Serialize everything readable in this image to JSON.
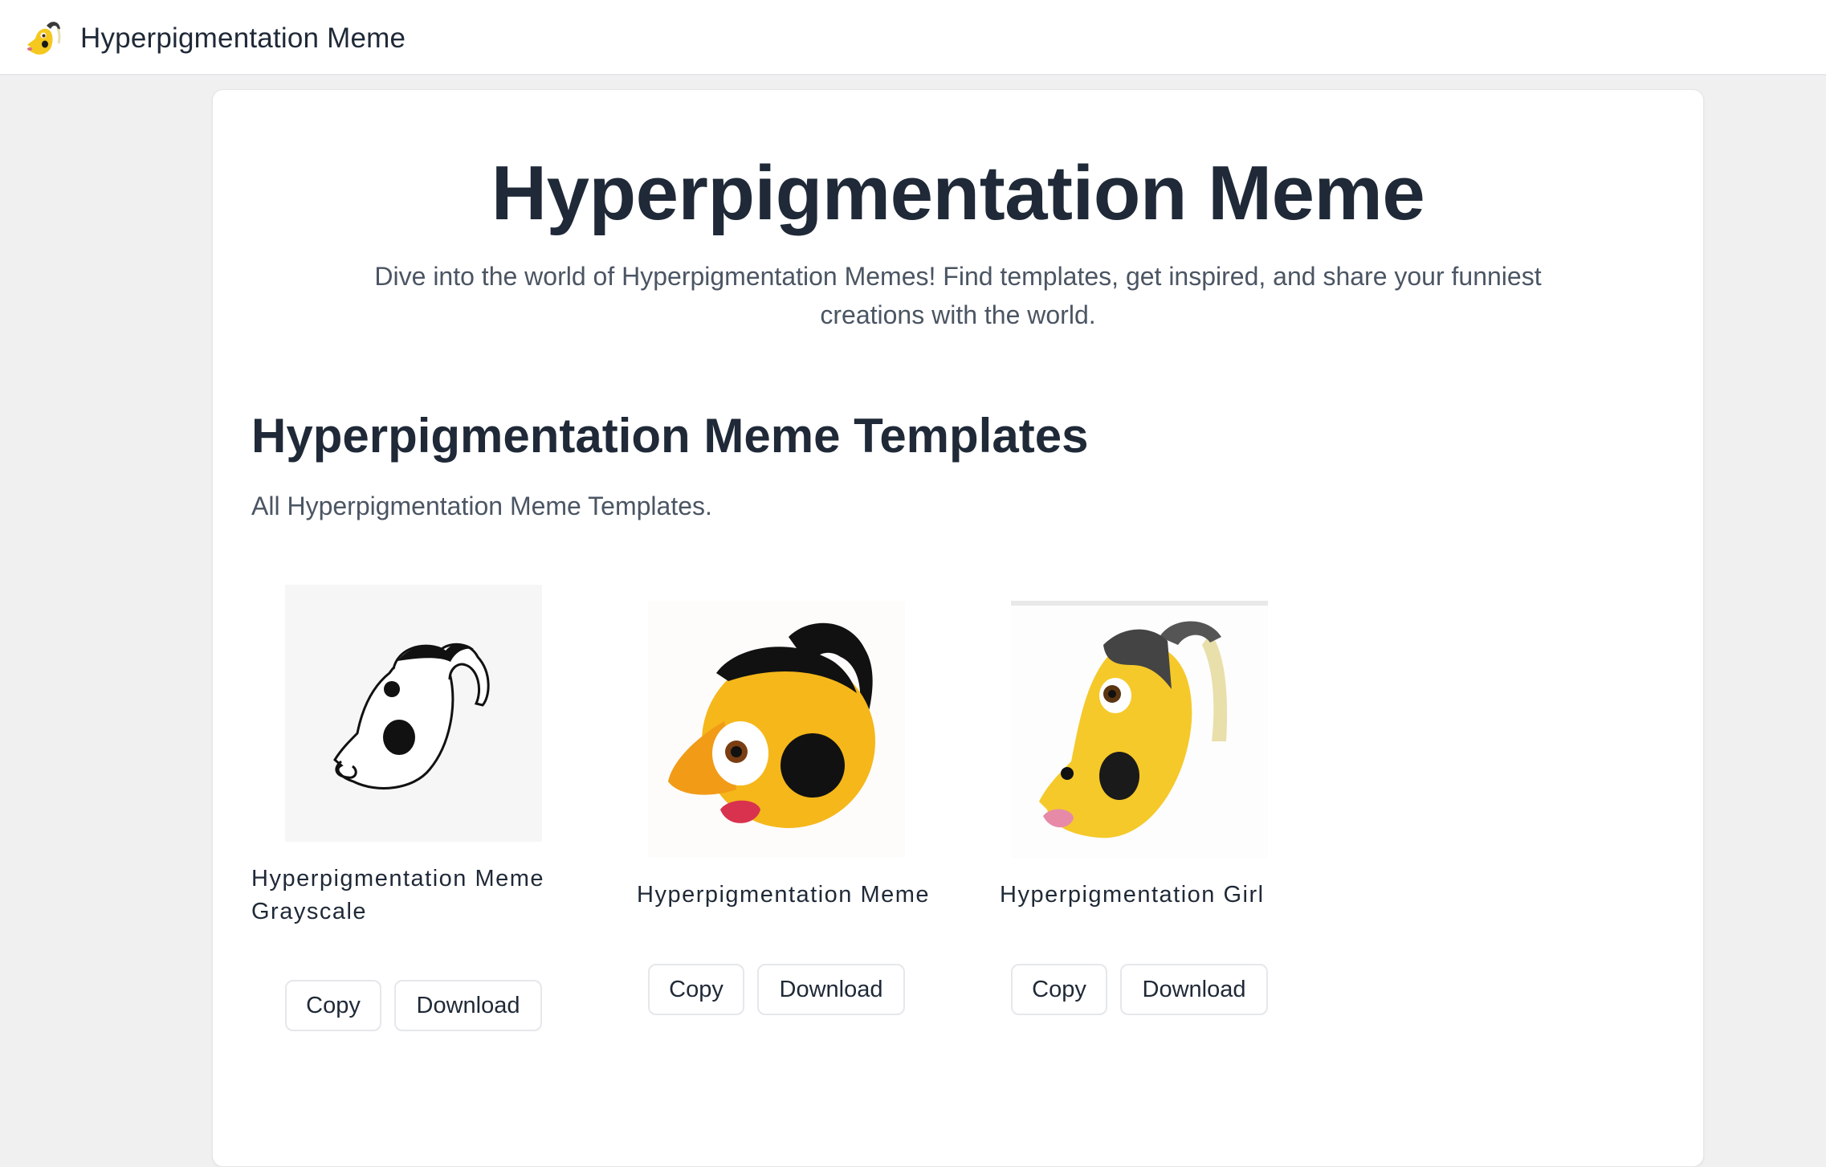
{
  "header": {
    "site_name": "Hyperpigmentation Meme",
    "logo_icon": "hyperpigmentation-emoji-logo"
  },
  "hero": {
    "title": "Hyperpigmentation Meme",
    "subtitle": "Dive into the world of Hyperpigmentation Memes! Find templates, get inspired, and share your funniest creations with the world."
  },
  "templates_section": {
    "title": "Hyperpigmentation Meme Templates",
    "description": "All Hyperpigmentation Meme Templates.",
    "items": [
      {
        "name_line1": "Hyperpigmentation Meme",
        "name_line2": "Grayscale",
        "copy_label": "Copy",
        "download_label": "Download",
        "image": "grayscale-drawing"
      },
      {
        "name_line1": "Hyperpigmentation Meme",
        "copy_label": "Copy",
        "download_label": "Download",
        "image": "emoji-round"
      },
      {
        "name_line1": "Hyperpigmentation Girl",
        "copy_label": "Copy",
        "download_label": "Download",
        "image": "emoji-girl"
      }
    ]
  },
  "colors": {
    "page_bg": "#f0f0f0",
    "card_bg": "#ffffff",
    "text_primary": "#1f2937",
    "text_secondary": "#4b5563",
    "button_border": "#e5e7eb",
    "emoji_yellow": "#f5c518",
    "emoji_lips": "#d8324f"
  }
}
